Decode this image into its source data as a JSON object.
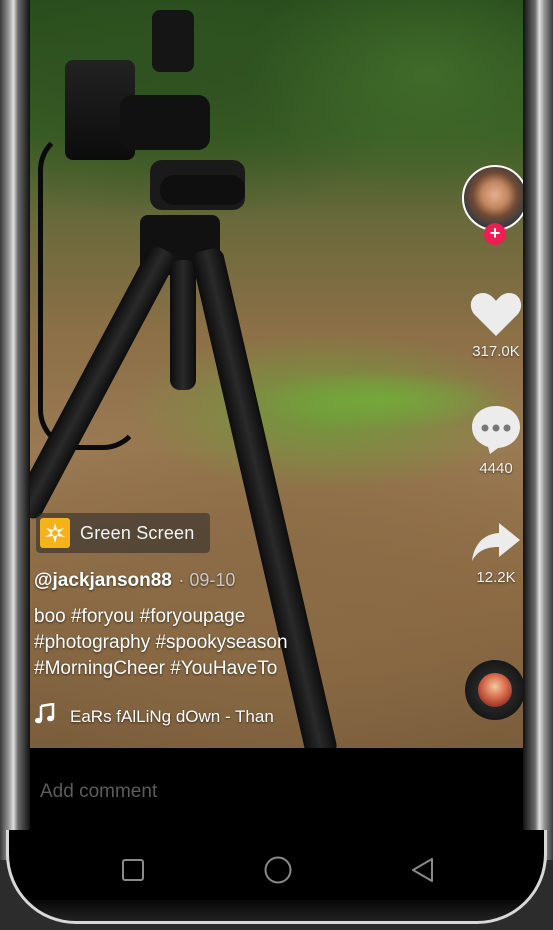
{
  "video": {
    "description_hidden": ""
  },
  "effect": {
    "label": "Green Screen",
    "icon": "sparkle-icon"
  },
  "post": {
    "username": "@jackjanson88",
    "date": "· 09-10",
    "caption_lines": [
      "boo #foryou #foryoupage",
      "#photography #spookyseason",
      "#MorningCheer #YouHaveTo"
    ]
  },
  "music": {
    "icon": "music-note-icon",
    "title": "EaRs fAlLiNg dOwn - Than"
  },
  "actions": {
    "likes": "317.0K",
    "comments": "4440",
    "shares": "12.2K",
    "follow_icon": "plus-icon"
  },
  "comment": {
    "placeholder": "Add comment"
  },
  "colors": {
    "follow_badge": "#ee1d52",
    "effect_icon_bg": "#f5b21b"
  },
  "nav": {
    "recent_icon": "square-icon",
    "home_icon": "circle-icon",
    "back_icon": "triangle-back-icon"
  }
}
